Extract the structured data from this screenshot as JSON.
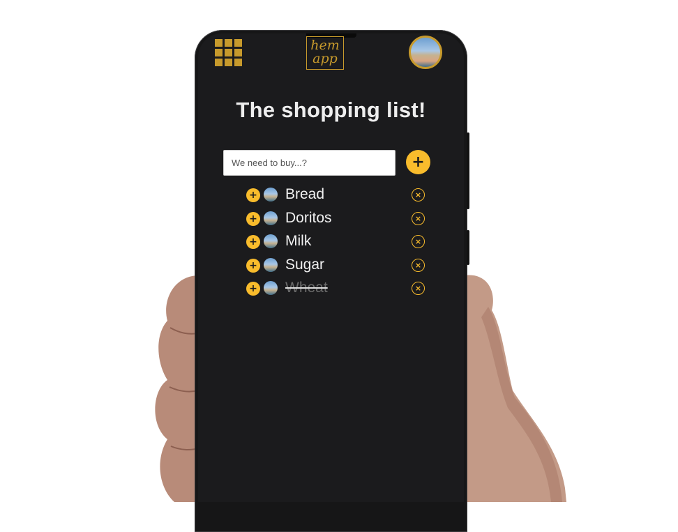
{
  "app": {
    "logo_text_line1": "hem",
    "logo_text_line2": "app",
    "title": "The shopping list!"
  },
  "form": {
    "input_placeholder": "We need to buy...?",
    "add_label": "+"
  },
  "list": {
    "items": [
      {
        "name": "Bread",
        "done": false
      },
      {
        "name": "Doritos",
        "done": false
      },
      {
        "name": "Milk",
        "done": false
      },
      {
        "name": "Sugar",
        "done": false
      },
      {
        "name": "Wheat",
        "done": true
      }
    ],
    "plus_symbol": "+",
    "remove_symbol": "×"
  },
  "colors": {
    "accent": "#f9bc2c",
    "logo_gold": "#c79a2c",
    "background": "#1b1b1d",
    "text": "#f0f0f0"
  },
  "icons": {
    "menu": "grid-icon",
    "add": "plus-icon",
    "remove": "close-circle-icon",
    "profile": "avatar"
  }
}
